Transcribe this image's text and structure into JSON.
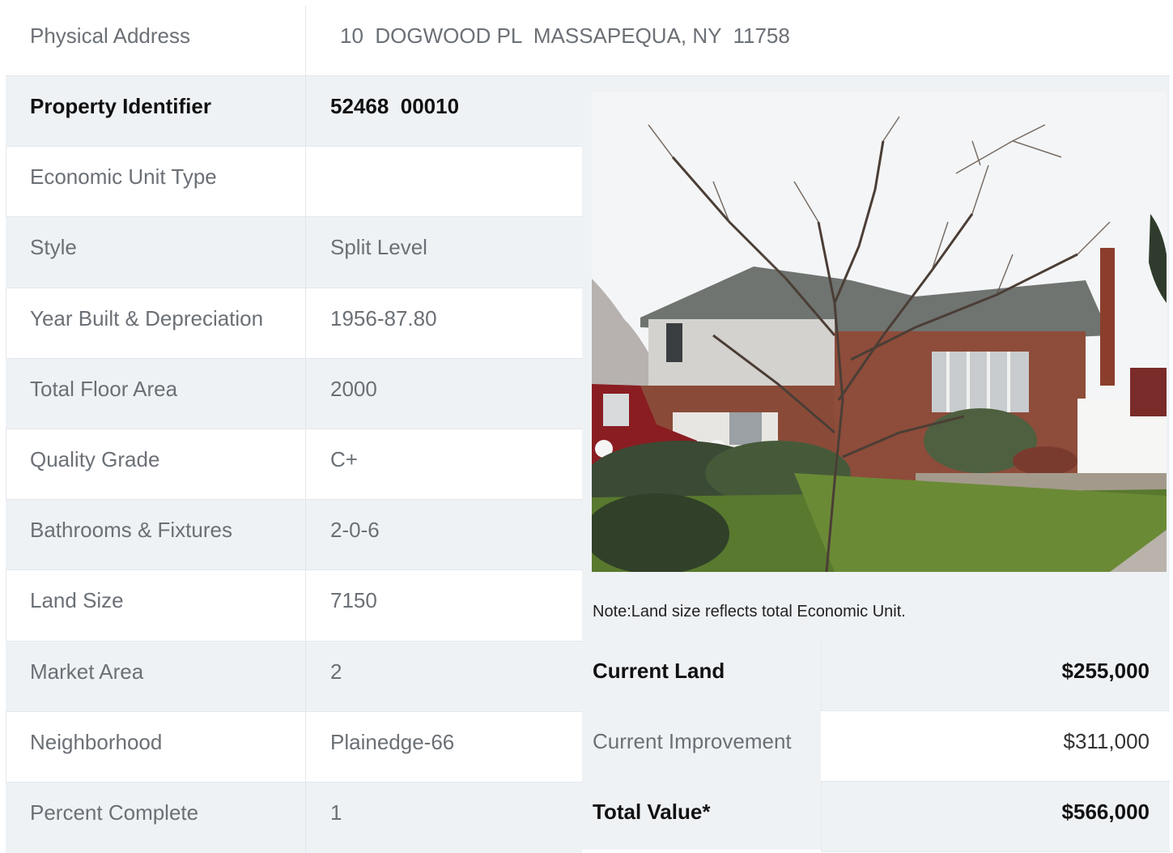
{
  "address": {
    "label": "Physical Address",
    "value": "10  DOGWOOD PL  MASSAPEQUA, NY  11758"
  },
  "details": [
    {
      "label": "Property Identifier",
      "value": "52468  00010"
    },
    {
      "label": "Economic Unit Type",
      "value": ""
    },
    {
      "label": "Style",
      "value": "Split Level"
    },
    {
      "label": "Year Built & Depreciation",
      "value": "1956-87.80"
    },
    {
      "label": "Total Floor Area",
      "value": "2000"
    },
    {
      "label": "Quality Grade",
      "value": "C+"
    },
    {
      "label": "Bathrooms & Fixtures",
      "value": "2-0-6"
    },
    {
      "label": "Land Size",
      "value": "7150"
    },
    {
      "label": "Market Area",
      "value": "2"
    },
    {
      "label": "Neighborhood",
      "value": "Plainedge-66"
    },
    {
      "label": "Percent Complete",
      "value": "1"
    }
  ],
  "note": "Note:Land size reflects total Economic Unit.",
  "values": [
    {
      "label": "Current Land",
      "amount": "$255,000"
    },
    {
      "label": "Current Improvement",
      "amount": "$311,000"
    },
    {
      "label": "Total Value*",
      "amount": "$566,000"
    }
  ]
}
